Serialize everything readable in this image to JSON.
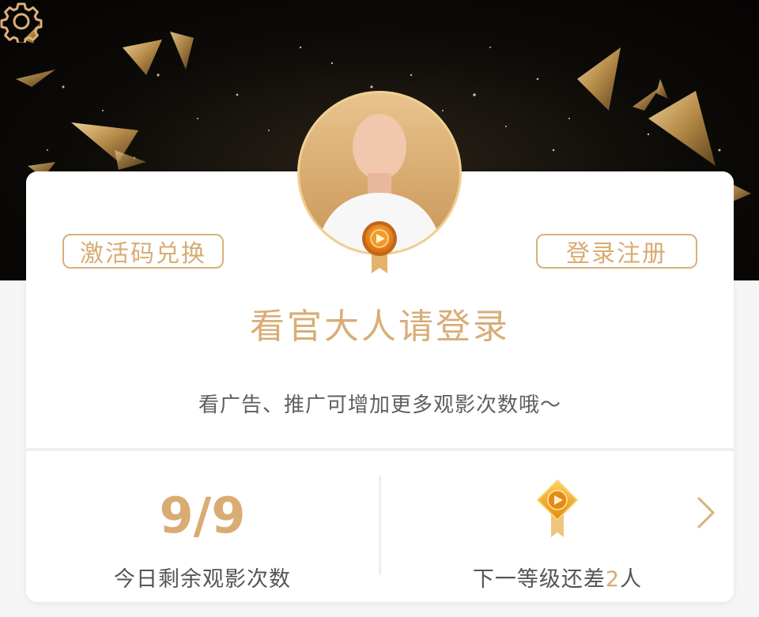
{
  "header": {
    "settings_icon": "gear-icon"
  },
  "card": {
    "redeem_button": "激活码兑换",
    "login_button": "登录注册",
    "title": "看官大人请登录",
    "hint": "看广告、推广可增加更多观影次数哦～"
  },
  "stats": {
    "remaining": {
      "value": "9/9",
      "label": "今日剩余观影次数"
    },
    "level": {
      "label_prefix": "下一等级还差",
      "count": "2",
      "label_suffix": "人",
      "icon": "medal-icon",
      "arrow_icon": "chevron-right-icon"
    }
  },
  "colors": {
    "accent": "#d8ad77",
    "hero_bg": "#0d0b08",
    "card_bg": "#ffffff",
    "text_gray": "#555555"
  }
}
